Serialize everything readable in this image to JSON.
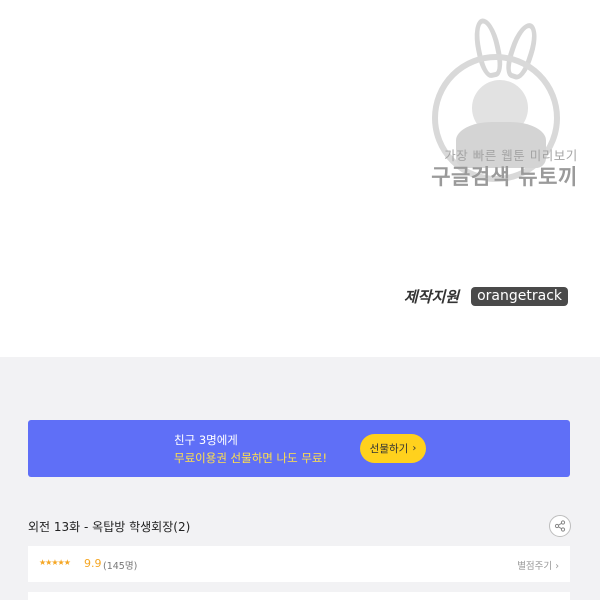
{
  "watermark": {
    "line1": "가장 빠른 웹툰 미리보기",
    "line2": "구글검색 뉴토끼"
  },
  "credits": {
    "label": "제작지원",
    "company": "orangetrack"
  },
  "promo": {
    "line1": "친구 3명에게",
    "line2": "무료이용권 선물하면 나도 무료!",
    "button_label": "선물하기",
    "button_icon": "chevron-right-icon",
    "colors": {
      "background": "#5f6ff7",
      "highlight": "#ffe04a",
      "button": "#ffd11d"
    }
  },
  "episode": {
    "title": "외전 13화 - 옥탑방 학생회장(2)",
    "share_icon": "share-icon"
  },
  "rating": {
    "stars": "★★★★★",
    "score": "9.9",
    "count": "(145명)",
    "rate_label": "별점주기",
    "rate_icon": "chevron-right-icon",
    "star_color": "#f5a623"
  }
}
